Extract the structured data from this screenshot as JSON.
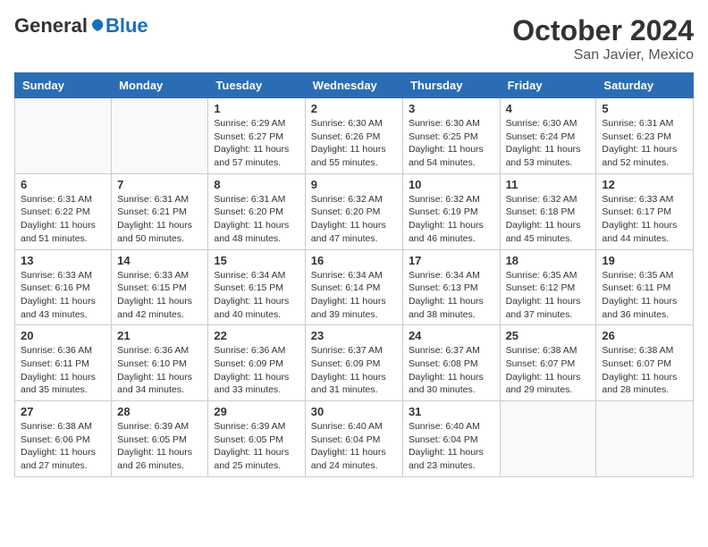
{
  "logo": {
    "general": "General",
    "blue": "Blue"
  },
  "header": {
    "month": "October 2024",
    "location": "San Javier, Mexico"
  },
  "weekdays": [
    "Sunday",
    "Monday",
    "Tuesday",
    "Wednesday",
    "Thursday",
    "Friday",
    "Saturday"
  ],
  "weeks": [
    [
      {
        "day": "",
        "info": ""
      },
      {
        "day": "",
        "info": ""
      },
      {
        "day": "1",
        "info": "Sunrise: 6:29 AM\nSunset: 6:27 PM\nDaylight: 11 hours and 57 minutes."
      },
      {
        "day": "2",
        "info": "Sunrise: 6:30 AM\nSunset: 6:26 PM\nDaylight: 11 hours and 55 minutes."
      },
      {
        "day": "3",
        "info": "Sunrise: 6:30 AM\nSunset: 6:25 PM\nDaylight: 11 hours and 54 minutes."
      },
      {
        "day": "4",
        "info": "Sunrise: 6:30 AM\nSunset: 6:24 PM\nDaylight: 11 hours and 53 minutes."
      },
      {
        "day": "5",
        "info": "Sunrise: 6:31 AM\nSunset: 6:23 PM\nDaylight: 11 hours and 52 minutes."
      }
    ],
    [
      {
        "day": "6",
        "info": "Sunrise: 6:31 AM\nSunset: 6:22 PM\nDaylight: 11 hours and 51 minutes."
      },
      {
        "day": "7",
        "info": "Sunrise: 6:31 AM\nSunset: 6:21 PM\nDaylight: 11 hours and 50 minutes."
      },
      {
        "day": "8",
        "info": "Sunrise: 6:31 AM\nSunset: 6:20 PM\nDaylight: 11 hours and 48 minutes."
      },
      {
        "day": "9",
        "info": "Sunrise: 6:32 AM\nSunset: 6:20 PM\nDaylight: 11 hours and 47 minutes."
      },
      {
        "day": "10",
        "info": "Sunrise: 6:32 AM\nSunset: 6:19 PM\nDaylight: 11 hours and 46 minutes."
      },
      {
        "day": "11",
        "info": "Sunrise: 6:32 AM\nSunset: 6:18 PM\nDaylight: 11 hours and 45 minutes."
      },
      {
        "day": "12",
        "info": "Sunrise: 6:33 AM\nSunset: 6:17 PM\nDaylight: 11 hours and 44 minutes."
      }
    ],
    [
      {
        "day": "13",
        "info": "Sunrise: 6:33 AM\nSunset: 6:16 PM\nDaylight: 11 hours and 43 minutes."
      },
      {
        "day": "14",
        "info": "Sunrise: 6:33 AM\nSunset: 6:15 PM\nDaylight: 11 hours and 42 minutes."
      },
      {
        "day": "15",
        "info": "Sunrise: 6:34 AM\nSunset: 6:15 PM\nDaylight: 11 hours and 40 minutes."
      },
      {
        "day": "16",
        "info": "Sunrise: 6:34 AM\nSunset: 6:14 PM\nDaylight: 11 hours and 39 minutes."
      },
      {
        "day": "17",
        "info": "Sunrise: 6:34 AM\nSunset: 6:13 PM\nDaylight: 11 hours and 38 minutes."
      },
      {
        "day": "18",
        "info": "Sunrise: 6:35 AM\nSunset: 6:12 PM\nDaylight: 11 hours and 37 minutes."
      },
      {
        "day": "19",
        "info": "Sunrise: 6:35 AM\nSunset: 6:11 PM\nDaylight: 11 hours and 36 minutes."
      }
    ],
    [
      {
        "day": "20",
        "info": "Sunrise: 6:36 AM\nSunset: 6:11 PM\nDaylight: 11 hours and 35 minutes."
      },
      {
        "day": "21",
        "info": "Sunrise: 6:36 AM\nSunset: 6:10 PM\nDaylight: 11 hours and 34 minutes."
      },
      {
        "day": "22",
        "info": "Sunrise: 6:36 AM\nSunset: 6:09 PM\nDaylight: 11 hours and 33 minutes."
      },
      {
        "day": "23",
        "info": "Sunrise: 6:37 AM\nSunset: 6:09 PM\nDaylight: 11 hours and 31 minutes."
      },
      {
        "day": "24",
        "info": "Sunrise: 6:37 AM\nSunset: 6:08 PM\nDaylight: 11 hours and 30 minutes."
      },
      {
        "day": "25",
        "info": "Sunrise: 6:38 AM\nSunset: 6:07 PM\nDaylight: 11 hours and 29 minutes."
      },
      {
        "day": "26",
        "info": "Sunrise: 6:38 AM\nSunset: 6:07 PM\nDaylight: 11 hours and 28 minutes."
      }
    ],
    [
      {
        "day": "27",
        "info": "Sunrise: 6:38 AM\nSunset: 6:06 PM\nDaylight: 11 hours and 27 minutes."
      },
      {
        "day": "28",
        "info": "Sunrise: 6:39 AM\nSunset: 6:05 PM\nDaylight: 11 hours and 26 minutes."
      },
      {
        "day": "29",
        "info": "Sunrise: 6:39 AM\nSunset: 6:05 PM\nDaylight: 11 hours and 25 minutes."
      },
      {
        "day": "30",
        "info": "Sunrise: 6:40 AM\nSunset: 6:04 PM\nDaylight: 11 hours and 24 minutes."
      },
      {
        "day": "31",
        "info": "Sunrise: 6:40 AM\nSunset: 6:04 PM\nDaylight: 11 hours and 23 minutes."
      },
      {
        "day": "",
        "info": ""
      },
      {
        "day": "",
        "info": ""
      }
    ]
  ]
}
